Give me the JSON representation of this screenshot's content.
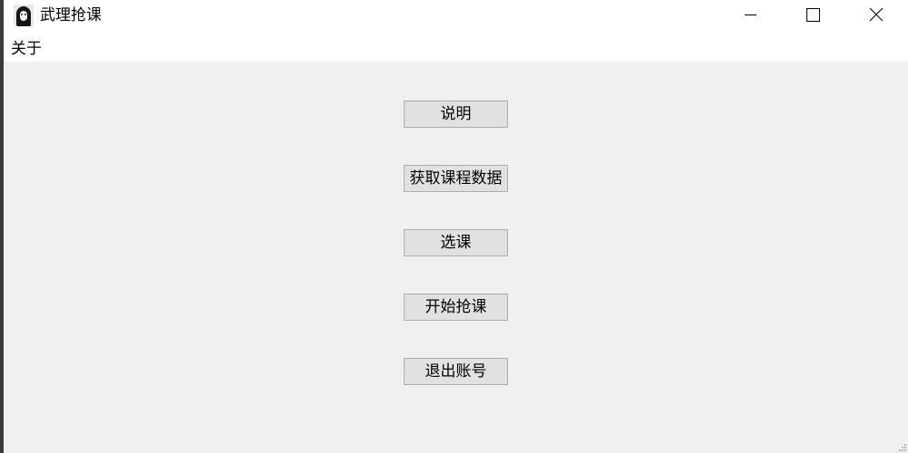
{
  "window": {
    "title": "武理抢课",
    "icon": "no-face-icon",
    "controls": {
      "minimize": "minimize-icon",
      "maximize": "maximize-icon",
      "close": "close-icon"
    }
  },
  "menu": {
    "items": [
      {
        "label": "关于"
      }
    ]
  },
  "main": {
    "buttons": [
      {
        "label": "说明"
      },
      {
        "label": "获取课程数据"
      },
      {
        "label": "选课"
      },
      {
        "label": "开始抢课"
      },
      {
        "label": "退出账号"
      }
    ]
  }
}
